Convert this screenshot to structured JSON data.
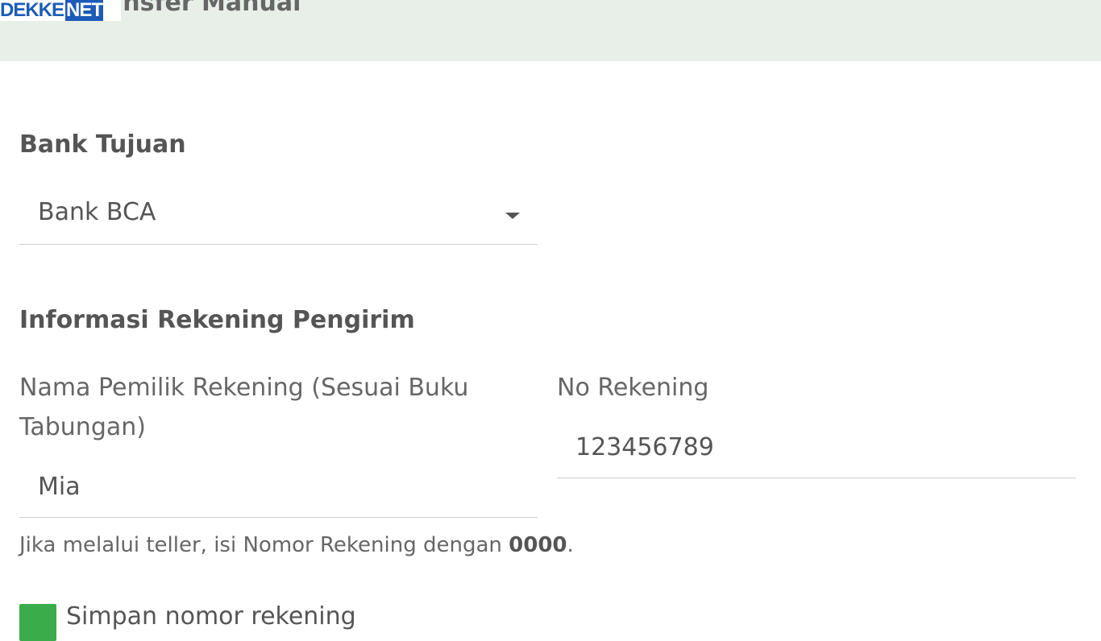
{
  "header": {
    "title": "Transfer Manual",
    "logo_main": "DEKKE",
    "logo_suffix": "NET"
  },
  "bank_section": {
    "title": "Bank Tujuan",
    "selected_bank": "Bank BCA"
  },
  "sender_section": {
    "title": "Informasi Rekening Pengirim",
    "name_label": "Nama Pemilik Rekening (Sesuai Buku Tabungan)",
    "name_value": "Mia",
    "account_label": "No Rekening",
    "account_value": "123456789",
    "helper_text": "Jika melalui teller, isi Nomor Rekening dengan ",
    "helper_bold": "0000",
    "helper_end": "."
  },
  "save_account": {
    "label": "Simpan nomor rekening",
    "checked": true
  },
  "colors": {
    "header_bg": "#e8efe9",
    "accent_green": "#3aac4a",
    "logo_blue": "#1d5bb8"
  }
}
